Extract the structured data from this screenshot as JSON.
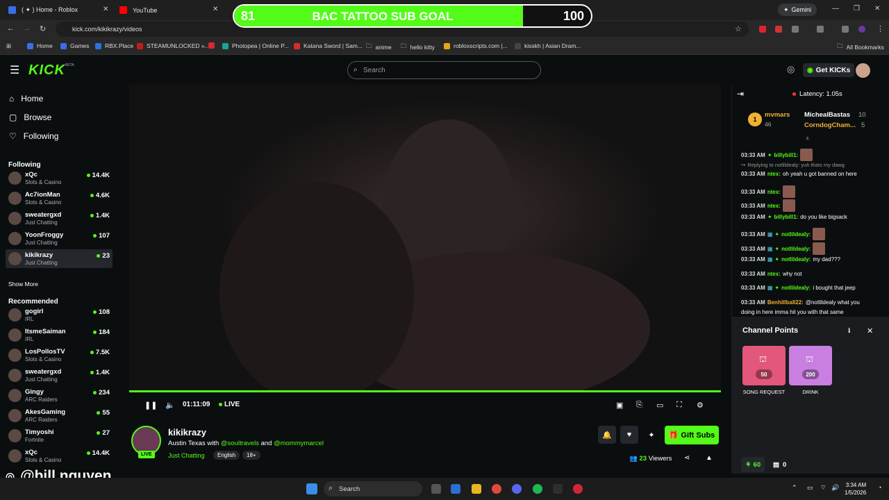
{
  "browser": {
    "tabs": [
      {
        "title": "( ✦ ) Home - Roblox",
        "color": "#3a6ee8"
      },
      {
        "title": "YouTube",
        "color": "#ff0000"
      }
    ],
    "gemini": "Gemini",
    "url": "kick.com/kikikrazy/videos",
    "bookmarks": [
      {
        "label": "Home",
        "color": "#3a6ee8"
      },
      {
        "label": "Games",
        "color": "#3a6ee8"
      },
      {
        "label": "RBX.Place",
        "color": "#2b73e0"
      },
      {
        "label": "STEAMUNLOCKED »...",
        "color": "#c61a1a"
      },
      {
        "label": "",
        "color": "#d32d2d"
      },
      {
        "label": "Photopea | Online P...",
        "color": "#18a497"
      },
      {
        "label": "Katana Sword | Sam...",
        "color": "#d32d2d"
      },
      {
        "label": "anime",
        "color": "folder"
      },
      {
        "label": "hello kitty",
        "color": "folder"
      },
      {
        "label": "robloxscripts.com |...",
        "color": "#e8a317"
      },
      {
        "label": "kisskh | Asian Dram...",
        "color": "#444"
      }
    ],
    "all_bookmarks": "All Bookmarks"
  },
  "sub_goal": {
    "current": 81,
    "target": 100,
    "title": "BAC TATTOO SUB GOAL",
    "progress": 0.81
  },
  "header": {
    "logo": "KICK",
    "beta": "BETA",
    "search_placeholder": "Search",
    "get_kicks": "Get KICKs"
  },
  "sidebar": {
    "nav": [
      {
        "label": "Home",
        "icon": "home-icon"
      },
      {
        "label": "Browse",
        "icon": "browse-icon"
      },
      {
        "label": "Following",
        "icon": "heart-icon"
      }
    ],
    "following_title": "Following",
    "following": [
      {
        "name": "xQc",
        "category": "Slots & Casino",
        "viewers": "14.4K"
      },
      {
        "name": "Ac7ionMan",
        "category": "Slots & Casino",
        "viewers": "4.6K"
      },
      {
        "name": "sweatergxd",
        "category": "Just Chatting",
        "viewers": "1.4K"
      },
      {
        "name": "YoonFroggy",
        "category": "Just Chatting",
        "viewers": "107"
      },
      {
        "name": "kikikrazy",
        "category": "Just Chatting",
        "viewers": "23"
      }
    ],
    "show_more": "Show More",
    "recommended_title": "Recommended",
    "recommended": [
      {
        "name": "gogirl",
        "category": "IRL",
        "viewers": "108"
      },
      {
        "name": "ItsmeSaiman",
        "category": "IRL",
        "viewers": "184"
      },
      {
        "name": "LosPollosTV",
        "category": "Slots & Casino",
        "viewers": "7.5K"
      },
      {
        "name": "sweatergxd",
        "category": "Just Chatting",
        "viewers": "1.4K"
      },
      {
        "name": "Gingy",
        "category": "ARC Raiders",
        "viewers": "234"
      },
      {
        "name": "AkesGaming",
        "category": "ARC Raiders",
        "viewers": "55"
      },
      {
        "name": "Timyoshi",
        "category": "Fortnite",
        "viewers": "27"
      },
      {
        "name": "xQc",
        "category": "Slots & Casino",
        "viewers": "14.4K"
      }
    ]
  },
  "player": {
    "time": "01:11:09",
    "live": "LIVE"
  },
  "stream": {
    "name": "kikikrazy",
    "title_pre": "Austin Texas with ",
    "mention1": "@soultravels",
    "title_and": " and ",
    "mention2": "@mommymarcel",
    "category": "Just Chatting",
    "tags": [
      "English",
      "18+"
    ],
    "live": "LIVE",
    "gift_subs": "Gift Subs",
    "viewers_count": "23",
    "viewers_label": "Viewers"
  },
  "chat": {
    "latency": "Latency: 1.05s",
    "leaderboard": {
      "top": {
        "rank": "1",
        "name": "mvmars",
        "value": "46"
      },
      "second": {
        "name": "MichealBastas",
        "value": "10"
      },
      "third": {
        "name": "CorndogCham...",
        "value": "5"
      }
    },
    "messages": [
      {
        "time": "03:33 AM",
        "user": "billybill1:",
        "text": "",
        "color": "#53fc18",
        "emote": true,
        "badges": 1
      },
      {
        "time": "",
        "user": "",
        "text": "Replying to notlildealy: yuh thats my dawg",
        "reply": true
      },
      {
        "time": "03:33 AM",
        "user": "ntex:",
        "text": "oh yeah u got banned on here",
        "color": "#53fc18",
        "badges": 0
      },
      {
        "time": "03:33 AM",
        "user": "ntex:",
        "text": "",
        "color": "#53fc18",
        "emote": true,
        "badges": 0
      },
      {
        "time": "03:33 AM",
        "user": "ntex:",
        "text": "",
        "color": "#53fc18",
        "emote": true,
        "badges": 0
      },
      {
        "time": "03:33 AM",
        "user": "billybill1:",
        "text": "do you like bigsack",
        "color": "#53fc18",
        "badges": 1
      },
      {
        "time": "03:33 AM",
        "user": "notlildealy:",
        "text": "",
        "color": "#53fc18",
        "emote": true,
        "badges": 2
      },
      {
        "time": "03:33 AM",
        "user": "notlildealy:",
        "text": "",
        "color": "#53fc18",
        "emote": true,
        "badges": 2
      },
      {
        "time": "03:33 AM",
        "user": "notlildealy:",
        "text": "my dad???",
        "color": "#53fc18",
        "badges": 2
      },
      {
        "time": "03:33 AM",
        "user": "ntex:",
        "text": "why not",
        "color": "#53fc18",
        "badges": 0
      },
      {
        "time": "03:33 AM",
        "user": "notlildealy:",
        "text": "i bought that jeep",
        "color": "#53fc18",
        "badges": 2
      },
      {
        "time": "03:33 AM",
        "user": "Benhillball22:",
        "text": "@notlildealy what you",
        "color": "#f2b134",
        "badges": 0
      },
      {
        "time": "",
        "user": "",
        "text": "doing in here imma hit you with that same",
        "cont": true
      }
    ]
  },
  "channel_points": {
    "title": "Channel Points",
    "rewards": [
      {
        "name": "SONG REQUEST",
        "cost": "50",
        "color": "#e2577a"
      },
      {
        "name": "DRINK",
        "cost": "200",
        "color": "#c97fe0"
      }
    ],
    "points": "60",
    "other": "0"
  },
  "watermark": "@bill.nguyen",
  "taskbar": {
    "search": "Search",
    "time": "3:34 AM",
    "date": "1/5/2026"
  }
}
